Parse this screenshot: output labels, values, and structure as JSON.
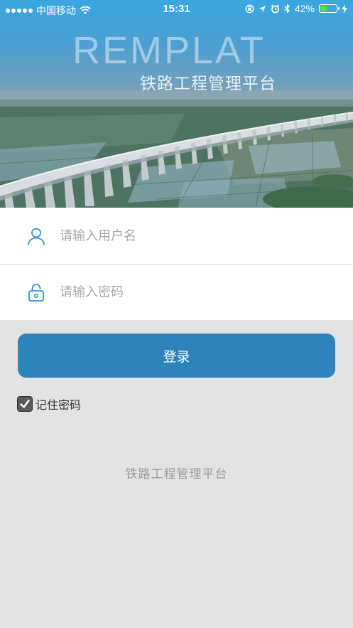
{
  "status_bar": {
    "carrier": "中国移动",
    "time": "15:31",
    "battery_percent": "42%",
    "battery_level": 0.42
  },
  "header": {
    "brand_title": "REMPLAT",
    "brand_subtitle": "铁路工程管理平台"
  },
  "form": {
    "username_placeholder": "请输入用户名",
    "password_placeholder": "请输入密码",
    "login_label": "登录",
    "remember_label": "记住密码",
    "remember_checked": true
  },
  "footer": {
    "text": "铁路工程管理平台"
  },
  "colors": {
    "accent": "#2e83bb",
    "icon": "#3a92c8"
  },
  "icons": [
    "wifi-icon",
    "lock-rotation-icon",
    "location-arrow-icon",
    "alarm-icon",
    "bluetooth-icon",
    "battery-icon",
    "charging-icon",
    "user-icon",
    "lock-icon",
    "checkmark-icon"
  ]
}
